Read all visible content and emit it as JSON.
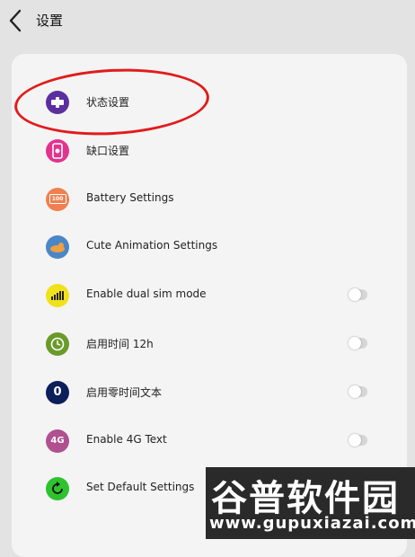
{
  "header": {
    "title": "设置"
  },
  "rows": [
    {
      "label": "状态设置",
      "icon": "status-settings-icon",
      "icon_color": "#5b2fa0",
      "has_toggle": false
    },
    {
      "label": "缺口设置",
      "icon": "notch-settings-icon",
      "icon_color": "#e2338f",
      "has_toggle": false
    },
    {
      "label": "Battery Settings",
      "icon": "battery-icon",
      "icon_color": "#f08050",
      "has_toggle": false,
      "icon_text": "100"
    },
    {
      "label": "Cute Animation Settings",
      "icon": "animation-icon",
      "icon_color": "#4a86c8",
      "has_toggle": false
    },
    {
      "label": "Enable dual sim mode",
      "icon": "signal-bars-icon",
      "icon_color": "#f0e21a",
      "has_toggle": true,
      "toggle_on": false
    },
    {
      "label": "启用时间 12h",
      "icon": "clock-icon",
      "icon_color": "#6a9a2a",
      "has_toggle": true,
      "toggle_on": false
    },
    {
      "label": "启用零时间文本",
      "icon": "zero-icon",
      "icon_color": "#0c1f5a",
      "has_toggle": true,
      "toggle_on": false,
      "icon_text": "0"
    },
    {
      "label": "Enable 4G Text",
      "icon": "4g-icon",
      "icon_color": "#b0508f",
      "has_toggle": true,
      "toggle_on": false,
      "icon_text": "4G"
    },
    {
      "label": "Set Default Settings",
      "icon": "reset-icon",
      "icon_color": "#2fc22f",
      "has_toggle": false
    }
  ],
  "watermark": {
    "text_cn": "谷普软件园",
    "url": "www.gupuxiazai.com"
  }
}
